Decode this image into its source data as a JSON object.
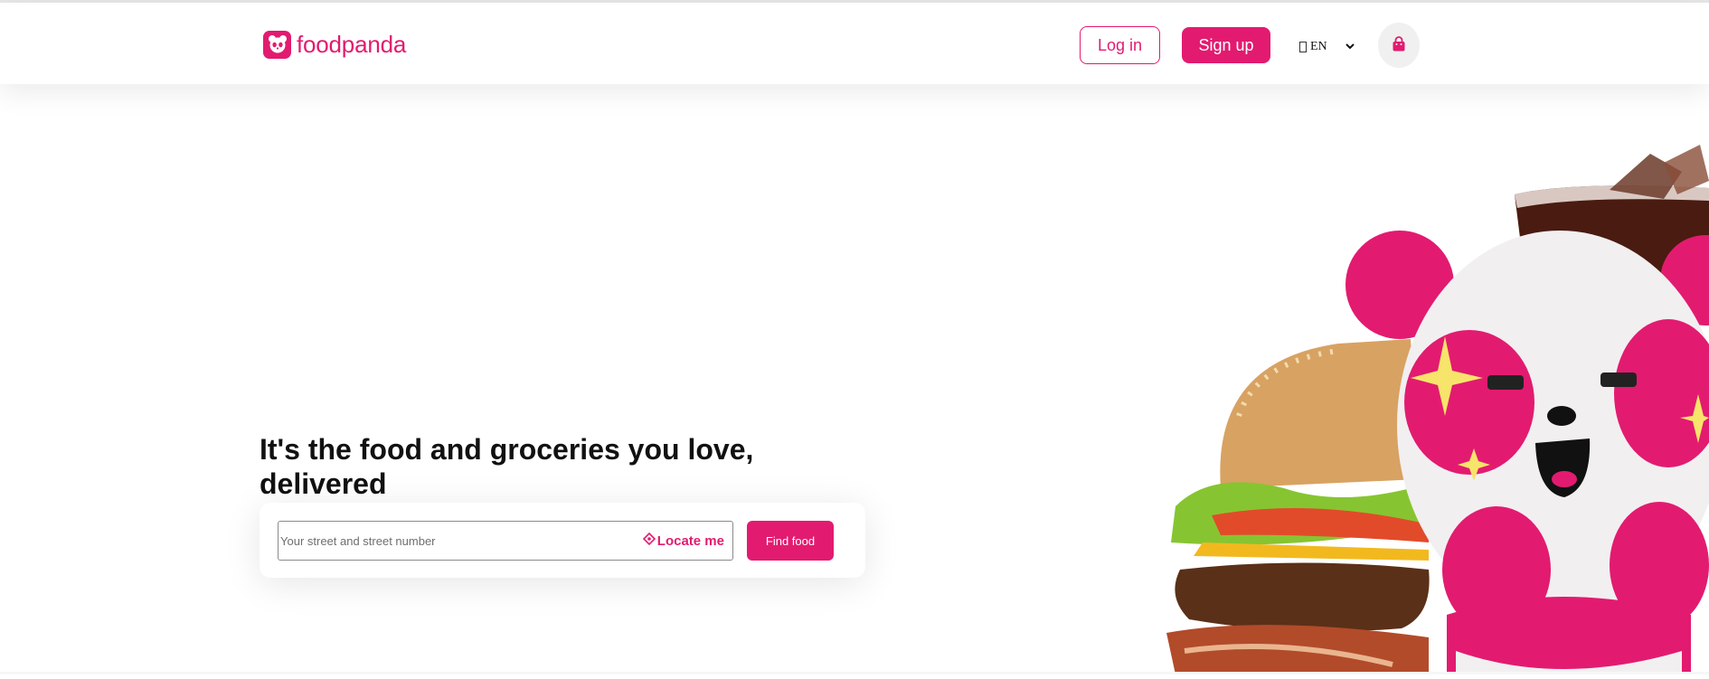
{
  "brand": {
    "name": "foodpanda",
    "color": "#e21b70"
  },
  "header": {
    "login_label": "Log in",
    "signup_label": "Sign up",
    "language": {
      "glyph": "",
      "selected": "EN"
    },
    "cart_icon": "shopping-bag-icon"
  },
  "hero": {
    "headline": "It's the food and groceries you love, delivered",
    "search": {
      "placeholder": "Your street and street number",
      "value": "",
      "locate_label": "Locate me",
      "locate_icon": "crosshair-icon",
      "find_label": "Find food"
    },
    "image_icons": [
      "burger-icon",
      "panda-mascot-icon",
      "drink-icon"
    ]
  }
}
